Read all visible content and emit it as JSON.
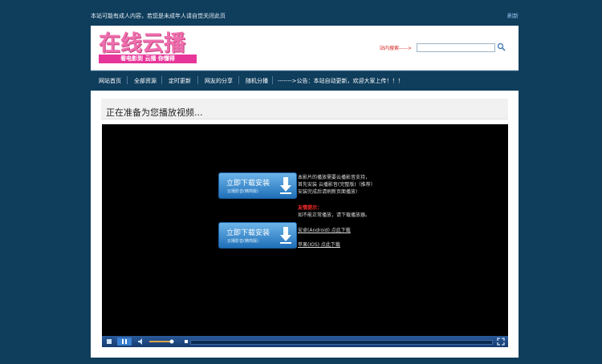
{
  "topbar": {
    "notice": "本站可能有成人内容，若您是未成年人请自觉关闭此页",
    "refresh": "刷新"
  },
  "logo": {
    "main": "在线云播",
    "tagline": "看电影到 云播 你懂得"
  },
  "search": {
    "label": "站内搜索----->",
    "placeholder": ""
  },
  "nav": {
    "items": [
      "网站首页",
      "全部资源",
      "定时更新",
      "网友的分享",
      "随机分播"
    ],
    "announcement": "------->公告：本站自动更新，欢迎大家上传！！！"
  },
  "panel": {
    "title": "正在准备为您播放视频..."
  },
  "player": {
    "buttons": [
      {
        "title": "立即下载安装",
        "sub": "云播影音(精简版)"
      },
      {
        "title": "立即下载安装",
        "sub": "云播影音(精简版)"
      }
    ],
    "info": {
      "line1": "本影片的播放需要云播影音支持，",
      "line2": "首先安装 云播影音(完整版)（推荐）",
      "line3": "安装完成后请刷新页面播放!",
      "tip_title": "友情提示：",
      "tip_text": "如不能正常播放，请下载播放器。",
      "link1": "安卓(Android) 点此下载",
      "link2": "苹果(IOS) 点此下载"
    }
  },
  "colors": {
    "background": "#0f3d5c",
    "logo_pink": "#ef6fae",
    "tag_pink": "#e7359a",
    "search_label_red": "#d41d1d",
    "tip_red": "#ff2a2a",
    "button_blue": "#1f6fb8"
  }
}
